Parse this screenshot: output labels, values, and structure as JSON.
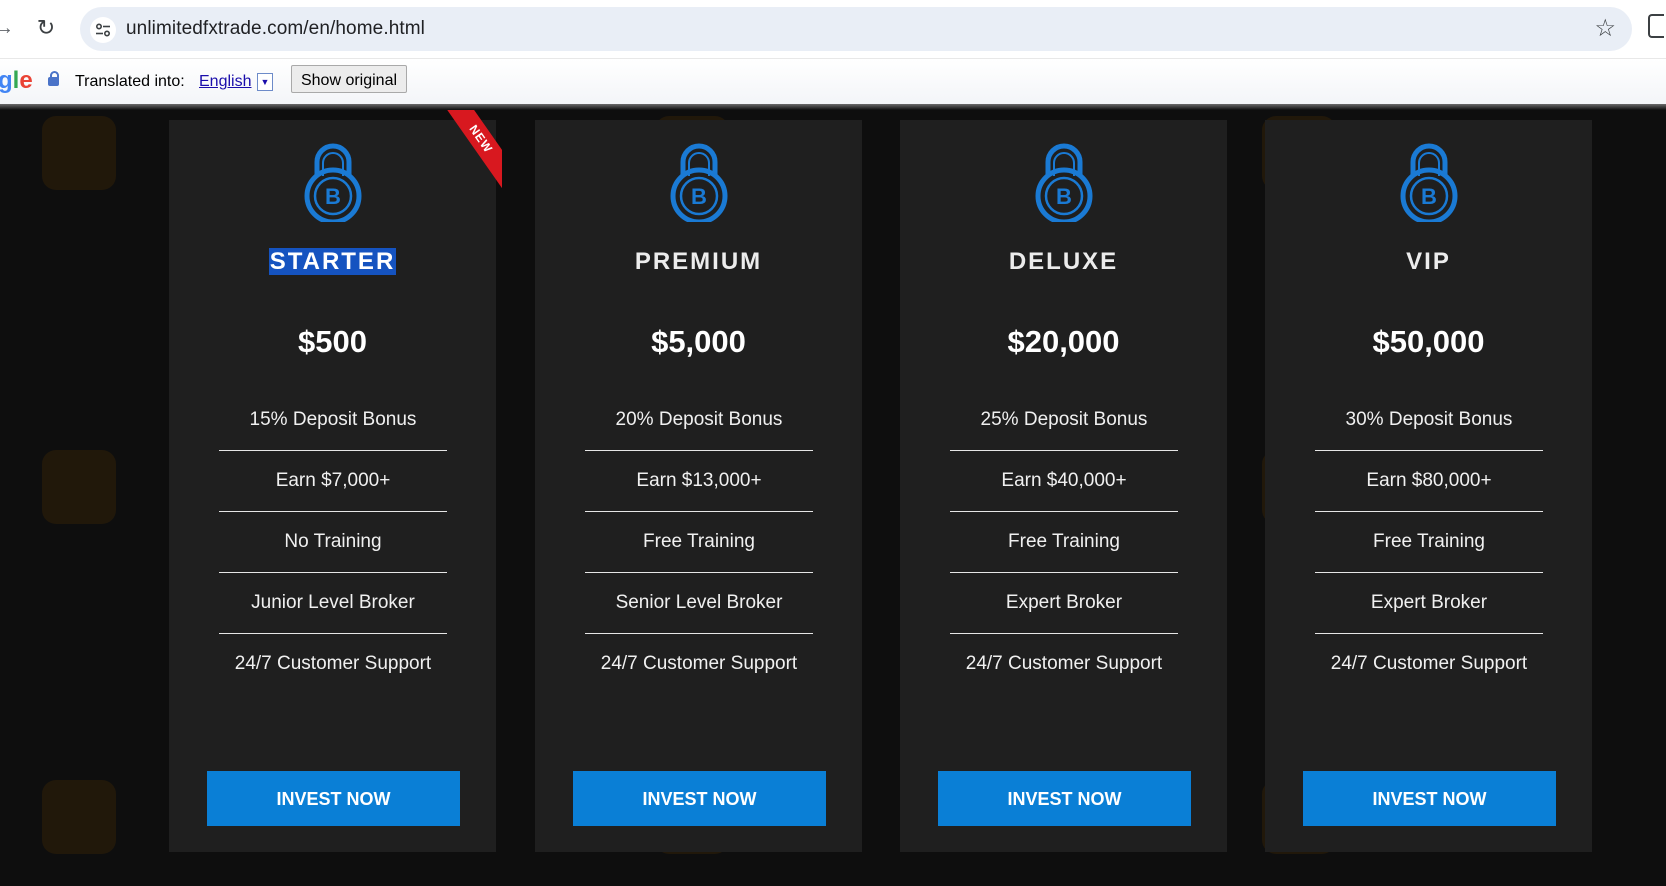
{
  "browser": {
    "url": "unlimitedfxtrade.com/en/home.html"
  },
  "translate_bar": {
    "logo_text": "gle",
    "translated_into_label": "Translated into:",
    "language": "English",
    "language_arrow": "▼",
    "show_original_label": "Show original"
  },
  "plans": [
    {
      "tier": "STARTER",
      "price": "$500",
      "ribbon": "NEW",
      "features": [
        "15% Deposit Bonus",
        "Earn $7,000+",
        "No Training",
        "Junior Level Broker",
        "24/7 Customer Support"
      ],
      "button_label": "INVEST NOW"
    },
    {
      "tier": "PREMIUM",
      "price": "$5,000",
      "features": [
        "20% Deposit Bonus",
        "Earn $13,000+",
        "Free Training",
        "Senior Level Broker",
        "24/7 Customer Support"
      ],
      "button_label": "INVEST NOW"
    },
    {
      "tier": "DELUXE",
      "price": "$20,000",
      "features": [
        "25% Deposit Bonus",
        "Earn $40,000+",
        "Free Training",
        "Expert Broker",
        "24/7 Customer Support"
      ],
      "button_label": "INVEST NOW"
    },
    {
      "tier": "VIP",
      "price": "$50,000",
      "features": [
        "30% Deposit Bonus",
        "Earn $80,000+",
        "Free Training",
        "Expert Broker",
        "24/7 Customer Support"
      ],
      "button_label": "INVEST NOW"
    }
  ],
  "colors": {
    "background": "#0e0e0e",
    "card": "#1f1f1f",
    "accent": "#0a7fd6",
    "icon": "#1a7ad4",
    "ribbon": "#d8181f",
    "selection": "#1553c0"
  },
  "icons": {
    "plan_icon": "bitcoin-padlock-icon",
    "reload": "reload-icon",
    "bookmark": "star-icon",
    "site_info": "tune-icon"
  }
}
